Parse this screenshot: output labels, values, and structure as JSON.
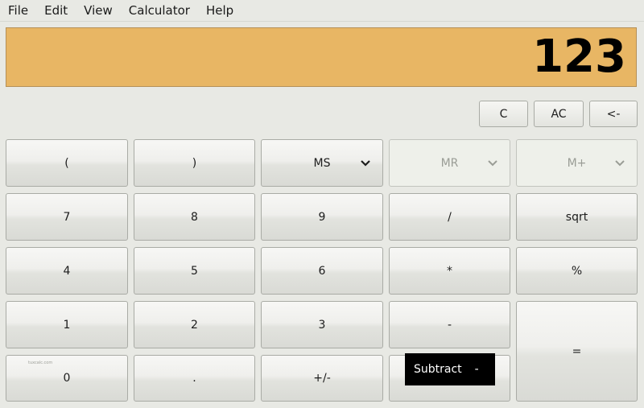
{
  "menu": [
    "File",
    "Edit",
    "View",
    "Calculator",
    "Help"
  ],
  "display": {
    "value": "123"
  },
  "clear_buttons": {
    "c": "C",
    "ac": "AC",
    "backspace": "<-"
  },
  "memory": {
    "ms": "MS",
    "mr": "MR",
    "mplus": "M+"
  },
  "keys": {
    "open_paren": "(",
    "close_paren": ")",
    "seven": "7",
    "eight": "8",
    "nine": "9",
    "divide": "/",
    "sqrt": "sqrt",
    "four": "4",
    "five": "5",
    "six": "6",
    "multiply": "*",
    "percent": "%",
    "one": "1",
    "two": "2",
    "three": "3",
    "subtract": "-",
    "equals": "=",
    "zero": "0",
    "decimal": ".",
    "negate": "+/-"
  },
  "tooltip": {
    "label": "Subtract",
    "shortcut": "-"
  },
  "watermark": "tuxcalc.com",
  "colors": {
    "display_bg": "#e8b664",
    "tooltip_bg": "#000000"
  }
}
